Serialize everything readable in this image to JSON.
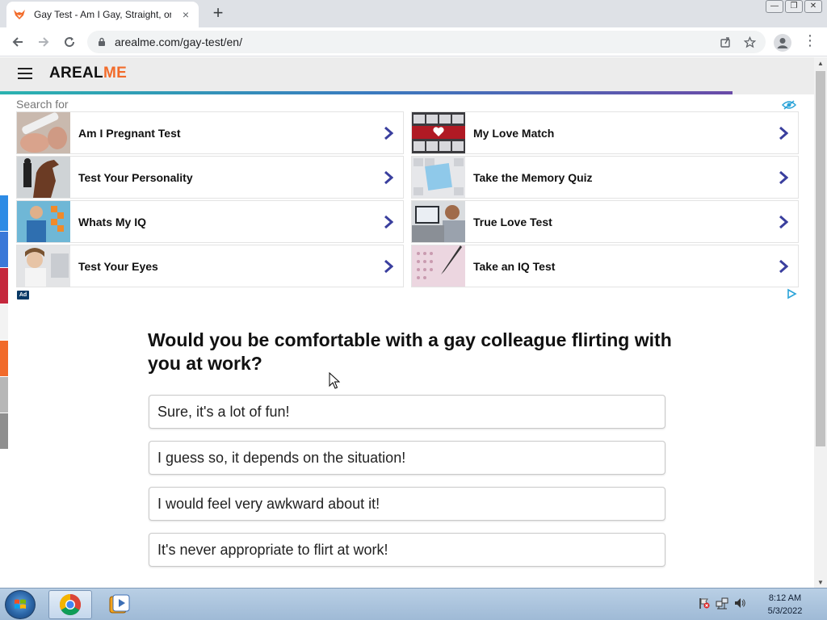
{
  "browser": {
    "tab_title": "Gay Test - Am I Gay, Straight, or Bi",
    "tab_close": "×",
    "new_tab": "+",
    "url": "arealme.com/gay-test/en/"
  },
  "site": {
    "logo_main": "AREAL",
    "logo_accent": "ME",
    "progress": 0.9
  },
  "ads": {
    "search_for": "Search for",
    "badge": "Ad",
    "items": [
      {
        "label": "Am I Pregnant Test",
        "thumb": "pregnancy-test-photo"
      },
      {
        "label": "My Love Match",
        "thumb": "keyboard-heart-photo"
      },
      {
        "label": "Test Your Personality",
        "thumb": "horse-rider-photo"
      },
      {
        "label": "Take the Memory Quiz",
        "thumb": "quiz-keyboard-photo"
      },
      {
        "label": "Whats My IQ",
        "thumb": "thinking-man-photo"
      },
      {
        "label": "True Love Test",
        "thumb": "laptop-user-photo"
      },
      {
        "label": "Test Your Eyes",
        "thumb": "tired-eyes-photo"
      },
      {
        "label": "Take an IQ Test",
        "thumb": "answer-sheet-photo"
      }
    ]
  },
  "quiz": {
    "question": "Would you be comfortable with a gay colleague flirting with you at work?",
    "answers": [
      "Sure, it's a lot of fun!",
      "I guess so, it depends on the situation!",
      "I would feel very awkward about it!",
      "It's never appropriate to flirt at work!"
    ]
  },
  "taskbar": {
    "time": "8:12 AM",
    "date": "5/3/2022"
  },
  "colors": {
    "logo_accent": "#f26b2a",
    "chevron": "#3a3f9e",
    "progress_start": "#2bb3b0",
    "progress_end": "#6a4ba8"
  }
}
